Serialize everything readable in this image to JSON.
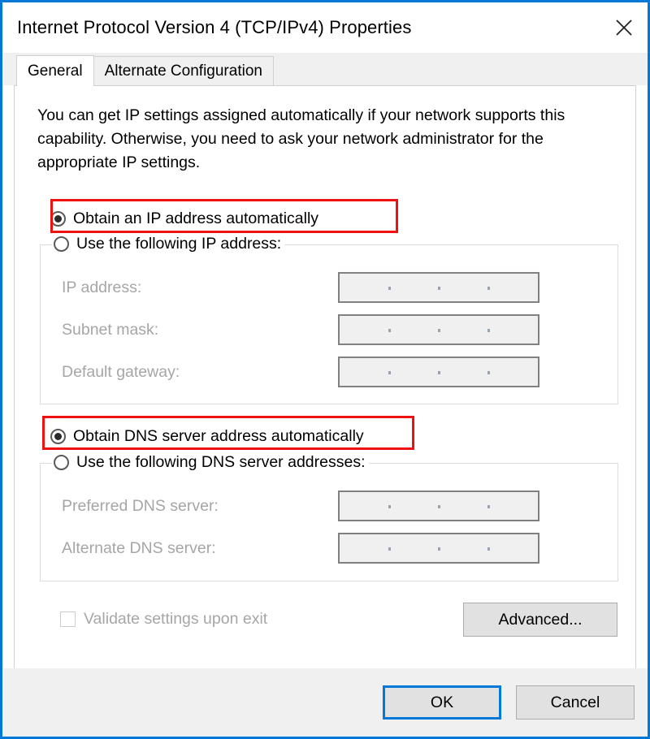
{
  "window": {
    "title": "Internet Protocol Version 4 (TCP/IPv4) Properties",
    "close_icon": "close-icon",
    "accent_color": "#0078d7",
    "highlight_color": "#ee1111"
  },
  "tabs": [
    {
      "label": "General",
      "active": true
    },
    {
      "label": "Alternate Configuration",
      "active": false
    }
  ],
  "general": {
    "intro": "You can get IP settings assigned automatically if your network supports this capability. Otherwise, you need to ask your network administrator for the appropriate IP settings.",
    "ip_mode": {
      "auto": {
        "label": "Obtain an IP address automatically",
        "selected": true,
        "highlighted": true
      },
      "manual": {
        "label": "Use the following IP address:",
        "selected": false,
        "highlighted": false
      }
    },
    "ip_fields": [
      {
        "label": "IP address:",
        "value": "",
        "enabled": false
      },
      {
        "label": "Subnet mask:",
        "value": "",
        "enabled": false
      },
      {
        "label": "Default gateway:",
        "value": "",
        "enabled": false
      }
    ],
    "dns_mode": {
      "auto": {
        "label": "Obtain DNS server address automatically",
        "selected": true,
        "highlighted": true
      },
      "manual": {
        "label": "Use the following DNS server addresses:",
        "selected": false,
        "highlighted": false
      }
    },
    "dns_fields": [
      {
        "label": "Preferred DNS server:",
        "value": "",
        "enabled": false
      },
      {
        "label": "Alternate DNS server:",
        "value": "",
        "enabled": false
      }
    ],
    "validate": {
      "label": "Validate settings upon exit",
      "checked": false,
      "enabled": false
    },
    "advanced_button": "Advanced..."
  },
  "footer": {
    "ok_label": "OK",
    "cancel_label": "Cancel"
  }
}
